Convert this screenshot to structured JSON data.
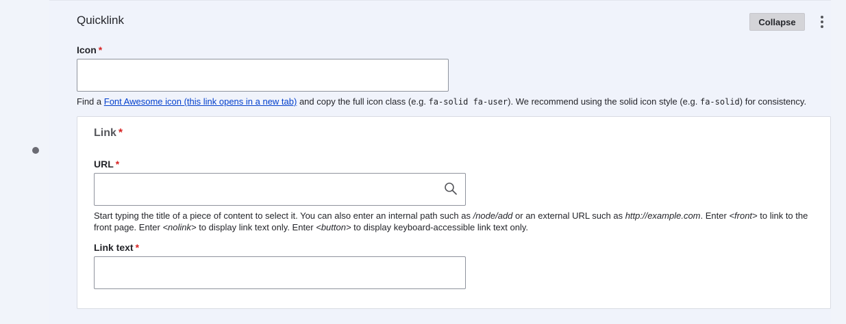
{
  "widget": {
    "title": "Quicklink",
    "collapse_label": "Collapse",
    "menu_icon": "kebab-vertical-icon",
    "drag_icon": "move-arrows-icon"
  },
  "icon_field": {
    "label": "Icon",
    "required_mark": "*",
    "value": "",
    "description_prefix": "Find a ",
    "description_link": "Font Awesome icon (this link opens in a new tab)",
    "description_mid": " and copy the full icon class (e.g. ",
    "description_code1": "fa-solid fa-user",
    "description_mid2": "). We recommend using the solid icon style (e.g. ",
    "description_code2": "fa-solid",
    "description_suffix": ") for consistency."
  },
  "link_group": {
    "legend": "Link",
    "required_mark": "*",
    "url": {
      "label": "URL",
      "required_mark": "*",
      "value": "",
      "search_icon": "search-icon",
      "desc_1": "Start typing the title of a piece of content to select it. You can also enter an internal path such as ",
      "desc_em1": "/node/add",
      "desc_2": " or an external URL such as ",
      "desc_em2": "http://example.com",
      "desc_3": ". Enter ",
      "desc_em3": "<front>",
      "desc_4": " to link to the front page. Enter ",
      "desc_em4": "<nolink>",
      "desc_5": " to display link text only. Enter ",
      "desc_em5": "<button>",
      "desc_6": " to display keyboard-accessible link text only."
    },
    "link_text": {
      "label": "Link text",
      "required_mark": "*",
      "value": ""
    }
  },
  "colors": {
    "accent_link": "#003ecc",
    "required": "#d72222",
    "panel_bg": "#f0f3fb"
  }
}
